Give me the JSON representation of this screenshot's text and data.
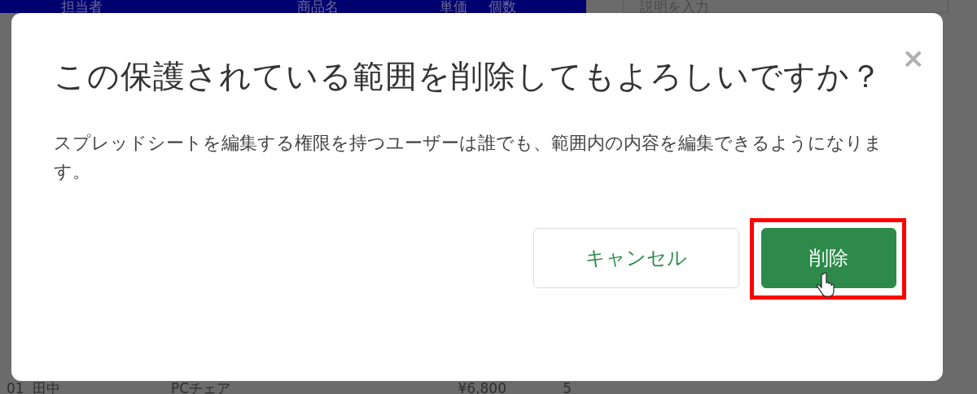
{
  "spreadsheet": {
    "header": [
      "担当者",
      "商品名",
      "単価",
      "個数"
    ],
    "description_field": {
      "placeholder": "説明を入力"
    },
    "last_row": {
      "row_number": "01",
      "cells": [
        "田中",
        "PCチェア",
        "¥6,800",
        "5"
      ]
    }
  },
  "dialog": {
    "title": "この保護されている範囲を削除してもよろしいですか？",
    "close": "×",
    "message": "スプレッドシートを編集する権限を持つユーザーは誰でも、範囲内の内容を編集できるようになります。",
    "buttons": [
      {
        "label": "キャンセル",
        "kind": "secondary",
        "highlighted": false
      },
      {
        "label": "削除",
        "kind": "primary",
        "highlighted": true
      }
    ]
  }
}
